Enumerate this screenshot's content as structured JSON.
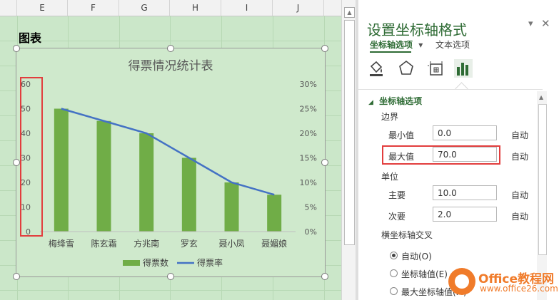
{
  "sheet": {
    "columns": [
      "E",
      "F",
      "G",
      "H",
      "I",
      "J"
    ],
    "title": "图表"
  },
  "chart_data": {
    "type": "bar",
    "title": "得票情况统计表",
    "categories": [
      "梅绛雪",
      "陈玄霜",
      "方兆南",
      "罗玄",
      "聂小凤",
      "聂媚娘"
    ],
    "series": [
      {
        "name": "得票数",
        "type": "bar",
        "axis": "left",
        "values": [
          50,
          45,
          40,
          30,
          20,
          15
        ]
      },
      {
        "name": "得票率",
        "type": "line",
        "axis": "right",
        "values": [
          0.25,
          0.225,
          0.2,
          0.15,
          0.1,
          0.075
        ]
      }
    ],
    "y_left_ticks": [
      "60",
      "50",
      "40",
      "30",
      "20",
      "10",
      "0"
    ],
    "y_right_ticks": [
      "30%",
      "25%",
      "20%",
      "15%",
      "10%",
      "5%",
      "0%"
    ],
    "ylim_left": [
      0,
      60
    ],
    "ylim_right": [
      0,
      0.3
    ],
    "legend": "bottom",
    "grid": false,
    "colors": {
      "bar": "#70ad47",
      "line": "#4472c4"
    }
  },
  "panel": {
    "title": "设置坐标轴格式",
    "tab_axis": "坐标轴选项",
    "tab_text": "文本选项",
    "section": "坐标轴选项",
    "bounds_label": "边界",
    "min_label": "最小值",
    "min_value": "0.0",
    "max_label": "最大值",
    "max_value": "70.0",
    "units_label": "单位",
    "major_label": "主要",
    "major_value": "10.0",
    "minor_label": "次要",
    "minor_value": "2.0",
    "auto": "自动",
    "cross_label": "横坐标轴交叉",
    "cross_auto": "自动(O)",
    "cross_value": "坐标轴值(E)",
    "cross_max": "最大坐标轴值(M)",
    "accent_color": "#2e6b34"
  },
  "watermark": {
    "name": "Office教程网",
    "url": "www.office26.com"
  }
}
